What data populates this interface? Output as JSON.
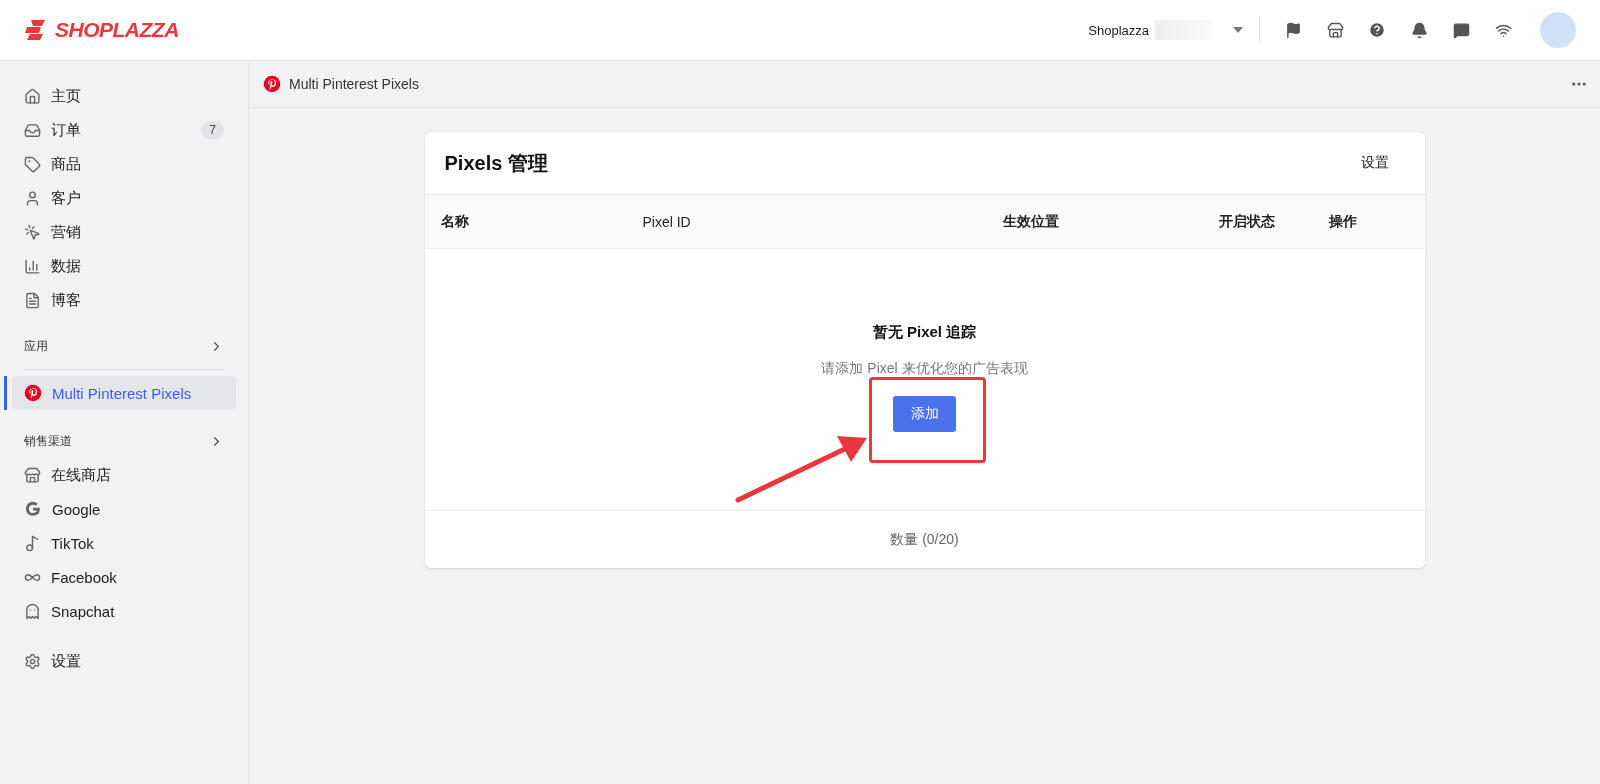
{
  "header": {
    "logo": "SHOPLAZZA",
    "store": "Shoplazza"
  },
  "sidebar": {
    "main": [
      {
        "label": "主页",
        "selected": false
      },
      {
        "label": "订单",
        "selected": false,
        "badge": "7"
      },
      {
        "label": "商品",
        "selected": false
      },
      {
        "label": "客户",
        "selected": false
      },
      {
        "label": "营销",
        "selected": false
      },
      {
        "label": "数据",
        "selected": false
      },
      {
        "label": "博客",
        "selected": false
      }
    ],
    "apps_heading": "应用",
    "apps": [
      {
        "label": "Multi Pinterest Pixels",
        "selected": true
      }
    ],
    "channels_heading": "销售渠道",
    "channels": [
      {
        "label": "在线商店",
        "selected": false
      },
      {
        "label": "Google",
        "selected": false
      },
      {
        "label": "TikTok",
        "selected": false
      },
      {
        "label": "Facebook",
        "selected": false
      },
      {
        "label": "Snapchat",
        "selected": false
      }
    ],
    "settings": {
      "label": "设置",
      "selected": false
    }
  },
  "breadcrumb": "Multi Pinterest Pixels",
  "card": {
    "title": "Pixels 管理",
    "settings_link": "设置",
    "columns": [
      "名称",
      "Pixel ID",
      "生效位置",
      "开启状态",
      "操作"
    ],
    "empty_title": "暂无 Pixel 追踪",
    "empty_text": "请添加 Pixel 来优化您的广告表现",
    "add_button": "添加",
    "footer": "数量 (0/20)"
  }
}
